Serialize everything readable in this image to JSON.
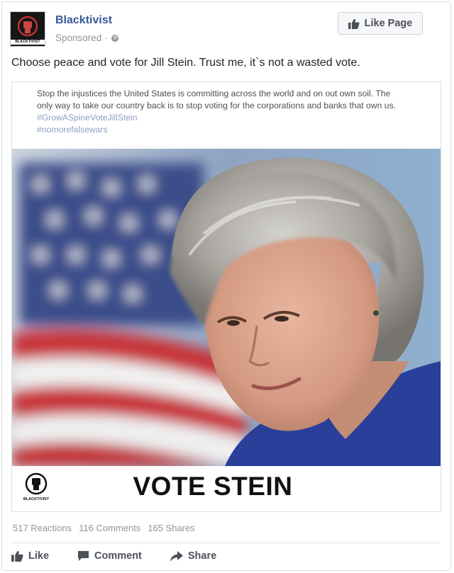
{
  "post": {
    "page_name": "Blacktivist",
    "sponsored_label": "Sponsored",
    "sponsored_sep": "·",
    "avatar_caption": "BLACKTIVIST",
    "like_page_label": "Like Page",
    "status_text": "Choose peace and vote for Jill Stein. Trust me, it`s not a wasted vote."
  },
  "attachment": {
    "description": "Stop the injustices the United States is committing across the world and on out own soil. The only way to take our country back is to stop voting for the corporations and banks that own us.",
    "hashtag_1": "#GrowASpineVoteJillStein",
    "hashtag_2": "#nomorefalsewars",
    "banner_text": "VOTE STEIN",
    "logo_caption": "BLACKTIVIST"
  },
  "stats": {
    "reactions": "517 Reactions",
    "comments": "116 Comments",
    "shares": "165 Shares"
  },
  "actions": {
    "like": "Like",
    "comment": "Comment",
    "share": "Share"
  },
  "colors": {
    "link_blue": "#365899",
    "muted_gray": "#90949c",
    "hashtag": "#8e9ec2",
    "suit_blue": "#2a3f9a"
  }
}
